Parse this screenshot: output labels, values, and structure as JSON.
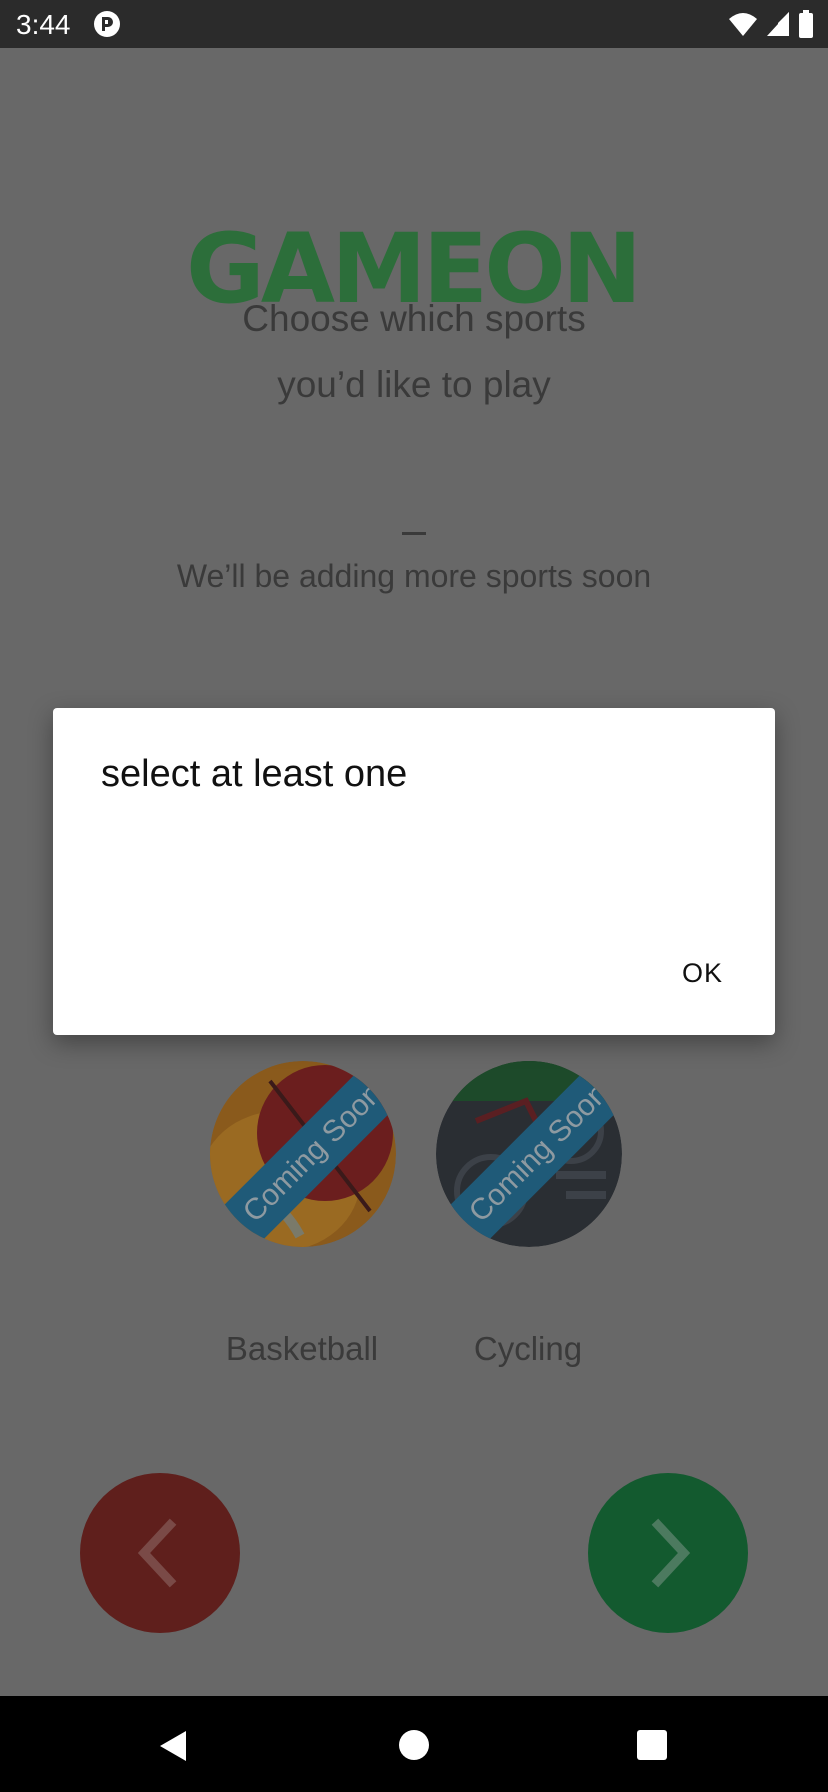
{
  "status_bar": {
    "time": "3:44",
    "icons": [
      "app-p-icon",
      "wifi-icon",
      "signal-icon",
      "battery-icon"
    ]
  },
  "logo": {
    "text": "GAMEON"
  },
  "screen": {
    "heading_line1": "Choose which sports",
    "heading_line2": "you’d like to play",
    "subline": "We’ll be adding more sports soon"
  },
  "sports": [
    {
      "name": "Basketball",
      "badge": "Coming Soon"
    },
    {
      "name": "Cycling",
      "badge": "Coming Soon"
    }
  ],
  "nav": {
    "back_icon": "chevron-left-icon",
    "next_icon": "chevron-right-icon"
  },
  "dialog": {
    "title": "select at least one",
    "ok_label": "OK"
  },
  "colors": {
    "logo_green": "#2c6e3a",
    "back_button": "#5f1f1c",
    "next_button": "#135a2f",
    "ribbon": "#1f5a78"
  }
}
